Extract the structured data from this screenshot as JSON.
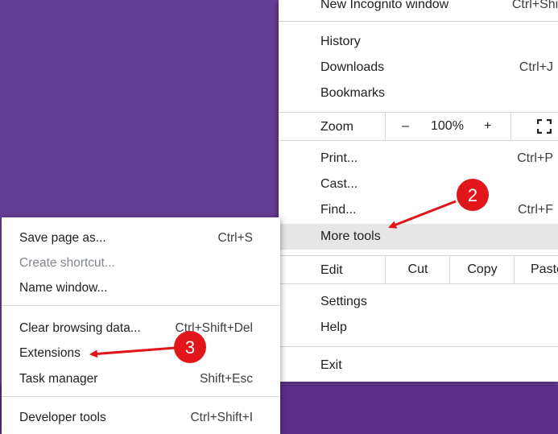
{
  "main_menu": {
    "new_incognito": {
      "label": "New Incognito window",
      "shortcut": "Ctrl+Shift+N"
    },
    "history": {
      "label": "History"
    },
    "downloads": {
      "label": "Downloads",
      "shortcut": "Ctrl+J"
    },
    "bookmarks": {
      "label": "Bookmarks"
    },
    "zoom": {
      "label": "Zoom",
      "minus": "–",
      "value": "100%",
      "plus": "+",
      "fullscreen_icon": "fullscreen-icon"
    },
    "print": {
      "label": "Print...",
      "shortcut": "Ctrl+P"
    },
    "cast": {
      "label": "Cast..."
    },
    "find": {
      "label": "Find...",
      "shortcut": "Ctrl+F"
    },
    "more_tools": {
      "label": "More tools"
    },
    "edit": {
      "label": "Edit",
      "cut": "Cut",
      "copy": "Copy",
      "paste": "Paste"
    },
    "settings": {
      "label": "Settings"
    },
    "help": {
      "label": "Help"
    },
    "exit": {
      "label": "Exit"
    }
  },
  "more_tools_submenu": {
    "save_page": {
      "label": "Save page as...",
      "shortcut": "Ctrl+S"
    },
    "create_shortcut": {
      "label": "Create shortcut..."
    },
    "name_window": {
      "label": "Name window..."
    },
    "clear_browsing": {
      "label": "Clear browsing data...",
      "shortcut": "Ctrl+Shift+Del"
    },
    "extensions": {
      "label": "Extensions"
    },
    "task_manager": {
      "label": "Task manager",
      "shortcut": "Shift+Esc"
    },
    "developer_tools": {
      "label": "Developer tools",
      "shortcut": "Ctrl+Shift+I"
    }
  },
  "annotations": {
    "step2": "2",
    "step3": "3",
    "color": "#e0161b"
  },
  "colors": {
    "background": "#653e96",
    "menu": "#ffffff",
    "highlight": "#e6e6e6"
  }
}
